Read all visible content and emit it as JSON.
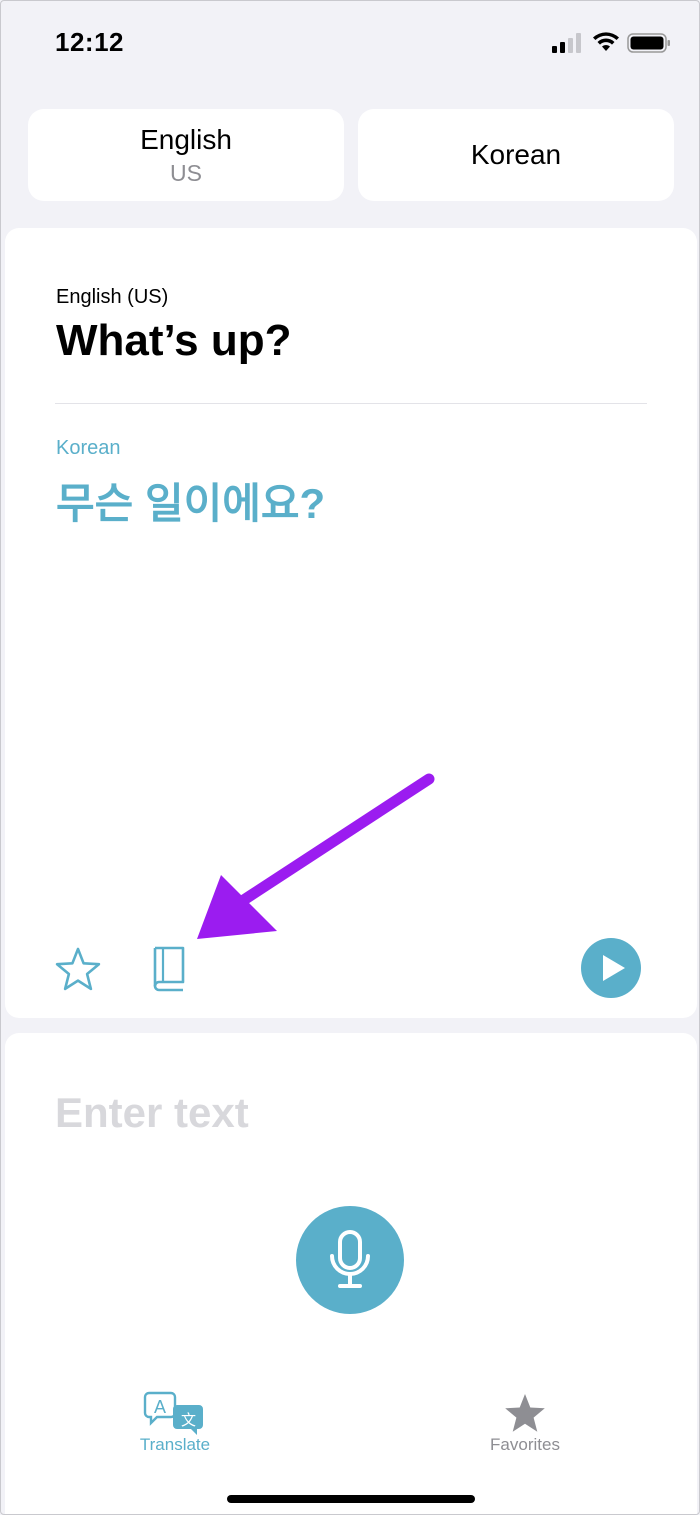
{
  "status_bar": {
    "time": "12:12"
  },
  "language_selector": {
    "source": {
      "name": "English",
      "region": "US"
    },
    "target": {
      "name": "Korean"
    }
  },
  "translation": {
    "source_language": "English (US)",
    "source_text": "What’s up?",
    "target_language": "Korean",
    "target_text": "무슨 일이에요?"
  },
  "card_actions": {
    "icons": [
      "star-icon",
      "book-icon",
      "play-icon"
    ]
  },
  "input": {
    "placeholder": "Enter text",
    "value": ""
  },
  "tab_bar": {
    "tabs": [
      {
        "label": "Translate",
        "icon": "translate-icon",
        "active": true
      },
      {
        "label": "Favorites",
        "icon": "star-icon",
        "active": false
      }
    ]
  },
  "colors": {
    "accent": "#5aafca",
    "annotation_arrow": "#9b1cf0",
    "background": "#f2f2f7"
  }
}
